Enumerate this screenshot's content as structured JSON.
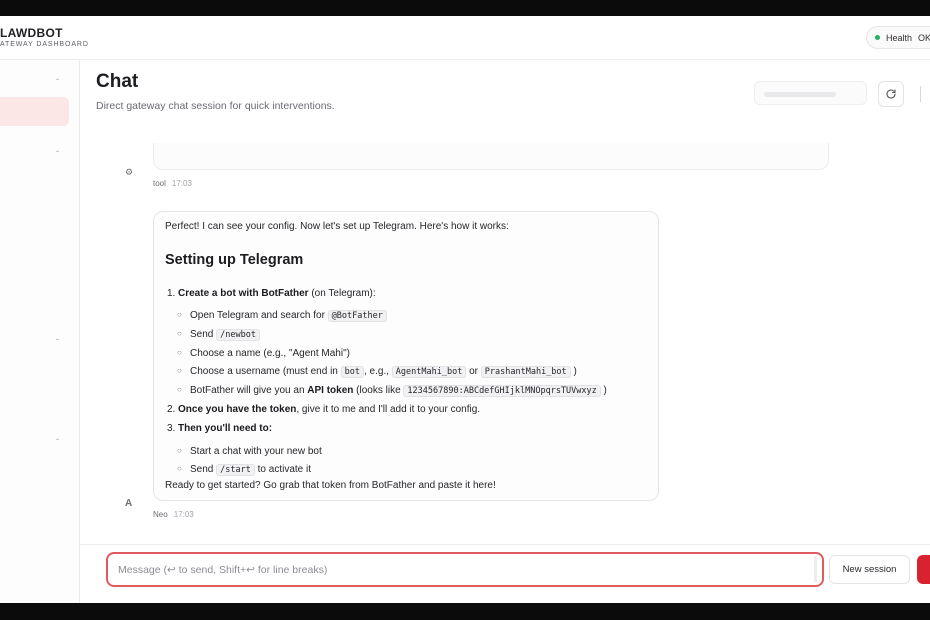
{
  "brand": {
    "title": "LAWDBOT",
    "subtitle": "ATEWAY DASHBOARD"
  },
  "health": {
    "label": "Health",
    "value": "OK"
  },
  "sidebar": {
    "marks": [
      "-",
      "-",
      "-",
      "-"
    ]
  },
  "page": {
    "title": "Chat",
    "subtitle": "Direct gateway chat session for quick interventions."
  },
  "prev_message": {
    "avatar": "⚙",
    "author": "tool",
    "time": "17:03"
  },
  "message": {
    "avatar": "A",
    "author": "Neo",
    "time": "17:03",
    "intro": "Perfect! I can see your config. Now let's set up Telegram. Here's how it works:",
    "heading": "Setting up Telegram",
    "step1": {
      "num": "1.",
      "bold": "Create a bot with BotFather",
      "rest": " (on Telegram):"
    },
    "step1_items": {
      "a": {
        "text": "Open Telegram and search for ",
        "code": "@BotFather"
      },
      "b": {
        "text": "Send ",
        "code": "/newbot"
      },
      "c": {
        "text": "Choose a name (e.g., \"Agent Mahi\")"
      },
      "d": {
        "text": "Choose a username (must end in ",
        "code1": "bot",
        "mid1": ", e.g., ",
        "code2": "AgentMahi_bot",
        "mid2": " or ",
        "code3": "PrashantMahi_bot",
        "end": " )"
      },
      "e": {
        "text": "BotFather will give you an ",
        "bold": "API token",
        "mid": " (looks like ",
        "code": "1234567890:ABCdefGHIjklMNOpqrsTUVwxyz",
        "end": " )"
      }
    },
    "step2": {
      "num": "2.",
      "bold": "Once you have the token",
      "rest": ", give it to me and I'll add it to your config."
    },
    "step3": {
      "num": "3.",
      "bold": "Then you'll need to:"
    },
    "step3_items": {
      "a": {
        "text": "Start a chat with your new bot"
      },
      "b": {
        "text": "Send ",
        "code": "/start",
        "end": " to activate it"
      }
    },
    "outro": "Ready to get started? Go grab that token from BotFather and paste it here!"
  },
  "composer": {
    "placeholder": "Message (↩ to send, Shift+↩ for line breaks)",
    "new_session_label": "New session"
  },
  "icons": {
    "refresh": "refresh-icon",
    "bullet": "○"
  },
  "colors": {
    "accent": "#d8222f",
    "input_border": "#e05a5f",
    "health_dot": "#22b35e",
    "active_nav": "#fce7e7"
  }
}
